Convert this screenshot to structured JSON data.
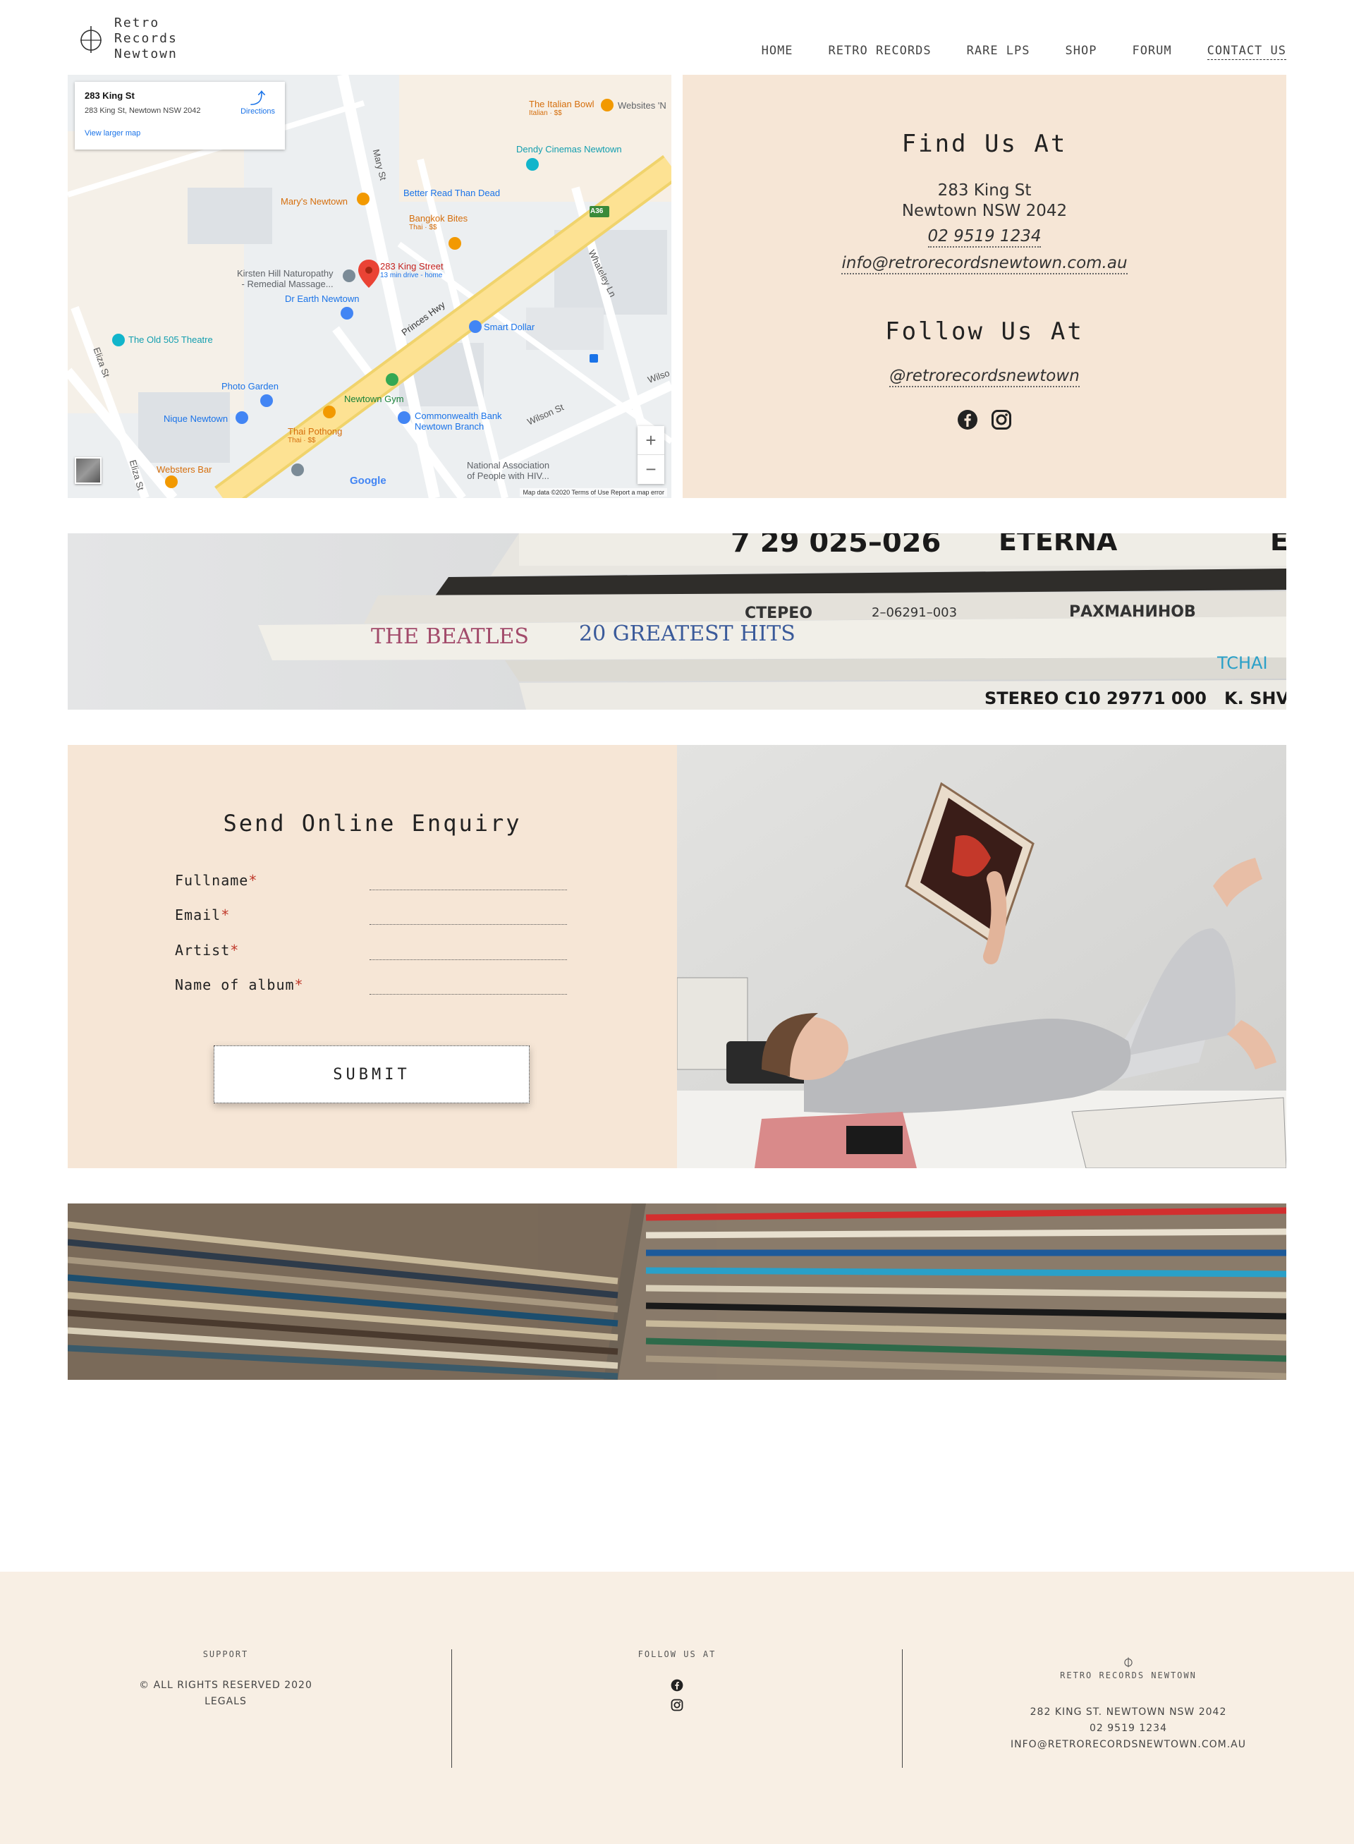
{
  "brand": {
    "logo_lines": [
      "Retro",
      "Records",
      "Newtown"
    ]
  },
  "nav": {
    "items": [
      "HOME",
      "RETRO RECORDS",
      "RARE LPS",
      "SHOP",
      "FORUM",
      "CONTACT US"
    ],
    "active": "CONTACT US"
  },
  "map": {
    "card_title": "283 King St",
    "card_address": "283 King St, Newtown NSW 2042",
    "directions_label": "Directions",
    "larger_map_label": "View larger map",
    "marker_label": "283 King Street",
    "marker_sub": "13 min drive - home",
    "pois": {
      "italian_bowl": "The Italian Bowl",
      "italian_bowl_sub": "Italian · $$",
      "websites": "Websites 'N",
      "dendy": "Dendy Cinemas Newtown",
      "better_read": "Better Read Than Dead",
      "marys": "Mary's Newtown",
      "bangkok": "Bangkok Bites",
      "bangkok_sub": "Thai · $$",
      "kirsten": "Kirsten Hill Naturopathy",
      "kirsten2": "- Remedial Massage...",
      "dr_earth": "Dr Earth Newtown",
      "smart_dollar": "Smart Dollar",
      "old505": "The Old 505 Theatre",
      "photo_garden": "Photo Garden",
      "newtown_gym": "Newtown Gym",
      "nique": "Nique Newtown",
      "thai_pothong": "Thai Pothong",
      "thai_pothong_sub": "Thai · $$",
      "cba": "Commonwealth Bank",
      "cba2": "Newtown Branch",
      "websters": "Websters Bar",
      "napwha": "National Association",
      "napwha2": "of People with HIV..."
    },
    "streets": {
      "princes": "Princes Hwy",
      "mary": "Mary St",
      "eliza": "Eliza St",
      "eliza2": "Eliza St",
      "whateley": "Whateley Ln",
      "wilson": "Wilson St",
      "wilson2": "Wilso",
      "a36": "A36"
    },
    "zoom_in": "+",
    "zoom_out": "−",
    "google": "Google",
    "footer": "Map data ©2020   Terms of Use   Report a map error"
  },
  "findus": {
    "heading": "Find Us At",
    "address_line1": "283 King St",
    "address_line2": "Newtown NSW 2042",
    "phone": "02 9519 1234",
    "email": "info@retrorecordsnewtown.com.au",
    "follow_heading": "Follow Us At",
    "handle": "@retrorecordsnewtown",
    "social_icons": [
      "facebook-icon",
      "instagram-icon"
    ]
  },
  "banner1": {
    "spine_texts": [
      "7 29 025–026",
      "ETERNA",
      "E",
      "СТЕРЕО",
      "2–06291–003",
      "РАХМАНИНОВ",
      "THE BEATLES",
      "20 GREATEST HITS",
      "TCHAI",
      "STEREO C10 29771 000",
      "K. SHV"
    ]
  },
  "enquiry": {
    "heading": "Send Online Enquiry",
    "fields": [
      {
        "label": "Fullname",
        "required": "*"
      },
      {
        "label": "Email",
        "required": "*"
      },
      {
        "label": "Artist",
        "required": "*"
      },
      {
        "label": "Name of album",
        "required": "*"
      }
    ],
    "submit_label": "SUBMIT"
  },
  "footer": {
    "support_title": "SUPPORT",
    "copyright": "© ALL RIGHTS RESERVED 2020",
    "legals": "LEGALS",
    "follow_title": "FOLLOW US AT",
    "brand_title": "RETRO RECORDS NEWTOWN",
    "address": "282 KING ST. NEWTOWN NSW 2042",
    "phone": "02 9519 1234",
    "email": "INFO@RETRORECORDSNEWTOWN.COM.AU"
  },
  "colors": {
    "panel_beige": "#f6e6d6",
    "footer_beige": "#f8efe4",
    "required_red": "#c0392b"
  }
}
